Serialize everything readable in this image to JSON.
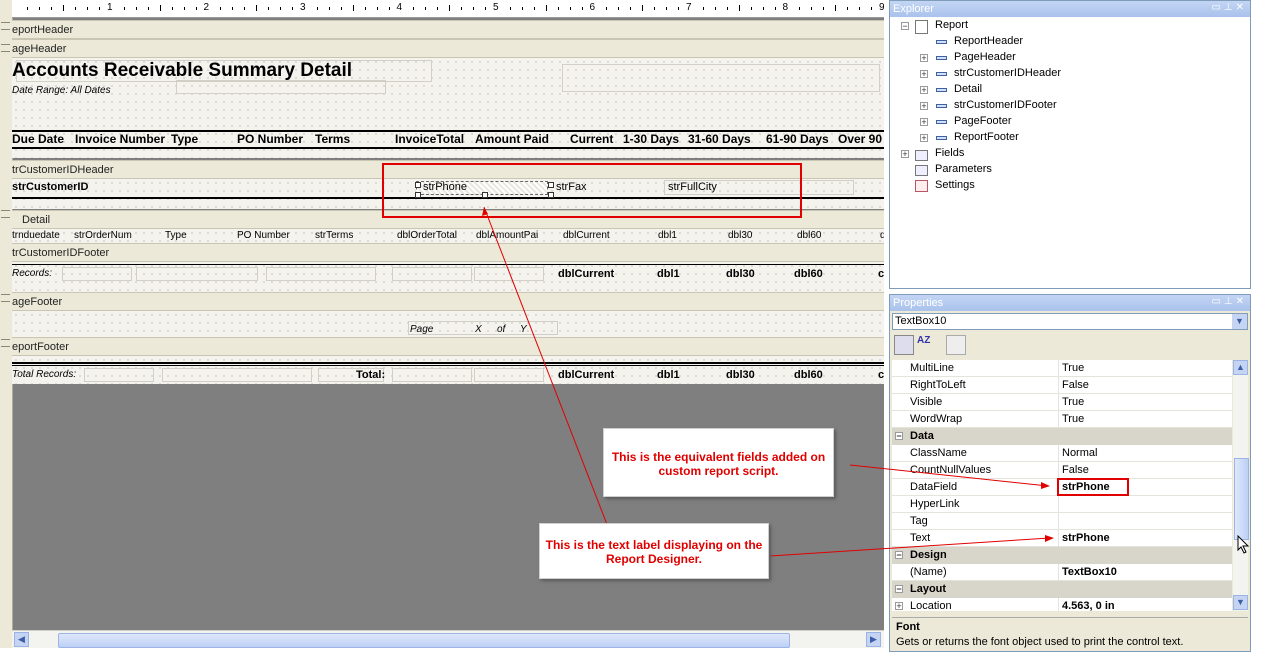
{
  "ruler": {
    "numbers": [
      "1",
      "2",
      "3",
      "4",
      "5",
      "6",
      "7",
      "8",
      "9"
    ]
  },
  "sections": {
    "report_header": "eportHeader",
    "page_header": "ageHeader",
    "group_header": "trCustomerIDHeader",
    "detail": "Detail",
    "group_footer": "trCustomerIDFooter",
    "page_footer": "ageFooter",
    "report_footer": "eportFooter"
  },
  "report_title": "Accounts Receivable Summary Detail",
  "date_range": "Date Range: All Dates",
  "columns": [
    "Due Date",
    "Invoice Number",
    "Type",
    "PO Number",
    "Terms",
    "InvoiceTotal",
    "Amount Paid",
    "Current",
    "1-30 Days",
    "31-60 Days",
    "61-90 Days",
    "Over 90"
  ],
  "group_header_fields": {
    "customer": "strCustomerID",
    "phone": "strPhone",
    "fax": "strFax",
    "city": "strFullCity"
  },
  "detail_fields": [
    "trnduedate",
    "strOrderNum",
    "Type",
    "PO Number",
    "strTerms",
    "dblOrderTotal",
    "dblAmountPai",
    "dblCurrent",
    "dbl1",
    "dbl30",
    "dbl60",
    "d"
  ],
  "group_footer": {
    "records": "Records:",
    "fields": [
      "dblCurrent",
      "dbl1",
      "dbl30",
      "dbl60",
      "c"
    ]
  },
  "page_footer": {
    "page": "Page",
    "x": "X",
    "of": "of",
    "y": "Y"
  },
  "report_footer": {
    "records": "Total Records:",
    "total": "Total:",
    "fields": [
      "dblCurrent",
      "dbl1",
      "dbl30",
      "dbl60",
      "c"
    ]
  },
  "explorer": {
    "title": "Explorer",
    "root": "Report",
    "items": [
      "ReportHeader",
      "PageHeader",
      "strCustomerIDHeader",
      "Detail",
      "strCustomerIDFooter",
      "PageFooter",
      "ReportFooter"
    ],
    "others": [
      "Fields",
      "Parameters",
      "Settings"
    ]
  },
  "properties": {
    "title": "Properties",
    "selected": "TextBox10",
    "rows": [
      {
        "name": "MultiLine",
        "value": "True"
      },
      {
        "name": "RightToLeft",
        "value": "False"
      },
      {
        "name": "Visible",
        "value": "True"
      },
      {
        "name": "WordWrap",
        "value": "True"
      }
    ],
    "data_cat": "Data",
    "data_rows": [
      {
        "name": "ClassName",
        "value": "Normal"
      },
      {
        "name": "CountNullValues",
        "value": "False"
      },
      {
        "name": "DataField",
        "value": "strPhone"
      },
      {
        "name": "HyperLink",
        "value": ""
      },
      {
        "name": "Tag",
        "value": ""
      },
      {
        "name": "Text",
        "value": "strPhone"
      }
    ],
    "design_cat": "Design",
    "design_rows": [
      {
        "name": "(Name)",
        "value": "TextBox10"
      }
    ],
    "layout_cat": "Layout",
    "layout_rows": [
      {
        "name": "Location",
        "value": "4.563, 0 in"
      }
    ],
    "desc_title": "Font",
    "desc_text": "Gets or returns the font object used to print the control text."
  },
  "callouts": {
    "fields": "This is the equivalent fields added on custom report script.",
    "label": "This is the text label displaying on the Report Designer."
  },
  "colors": {
    "annotation": "#e00000",
    "panel_title": "#a9c2ec"
  }
}
